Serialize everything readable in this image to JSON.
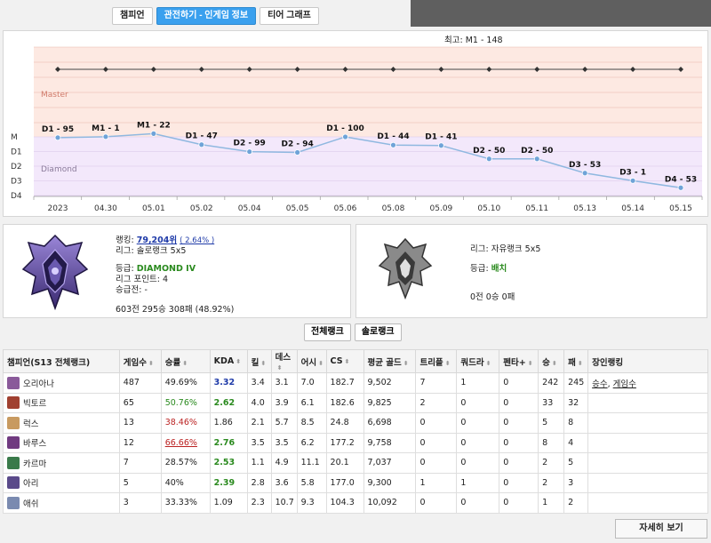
{
  "tabs": [
    "챔피언",
    "관전하기 - 인게임 정보",
    "티어 그래프"
  ],
  "chart": {
    "peak": "최고: M1 - 148",
    "y_labels": [
      "M",
      "D1",
      "D2",
      "D3",
      "D4"
    ],
    "zone_master": "Master",
    "zone_diamond": "Diamond",
    "x_labels": [
      "2023",
      "04.30",
      "05.01",
      "05.02",
      "05.04",
      "05.05",
      "05.06",
      "05.08",
      "05.09",
      "05.10",
      "05.11",
      "05.13",
      "05.14",
      "05.15"
    ],
    "point_labels": [
      "D1 - 95",
      "M1 - 1",
      "M1 - 22",
      "D1 - 47",
      "D2 - 99",
      "D2 - 94",
      "D1 - 100",
      "D1 - 44",
      "D1 - 41",
      "D2 - 50",
      "D2 - 50",
      "D3 - 53",
      "D3 - 1",
      "D4 - 53"
    ]
  },
  "chart_data": {
    "type": "line",
    "x": [
      "2023",
      "04.30",
      "05.01",
      "05.02",
      "05.04",
      "05.05",
      "05.06",
      "05.08",
      "05.09",
      "05.10",
      "05.11",
      "05.13",
      "05.14",
      "05.15"
    ],
    "series": [
      {
        "values": [
          -0.05,
          0.01,
          0.22,
          -0.53,
          -1.01,
          -1.06,
          0.0,
          -0.56,
          -0.59,
          -1.5,
          -1.5,
          -2.47,
          -2.99,
          -3.47
        ]
      }
    ],
    "y_ticks": [
      "M",
      "D1",
      "D2",
      "D3",
      "D4"
    ],
    "labels": [
      "D1 - 95",
      "M1 - 1",
      "M1 - 22",
      "D1 - 47",
      "D2 - 99",
      "D2 - 94",
      "D1 - 100",
      "D1 - 44",
      "D1 - 41",
      "D2 - 50",
      "D2 - 50",
      "D3 - 53",
      "D3 - 1",
      "D4 - 53"
    ]
  },
  "solo": {
    "ranking_label": "랭킹:",
    "ranking_value": "79,204위",
    "ranking_pct": "( 2.64% )",
    "league": "리그: 솔로랭크 5x5",
    "tier_label": "등급:",
    "tier_value": "DIAMOND IV",
    "lp": "리그 포인트: 4",
    "promo": "승급전: -",
    "record": "603전 295승 308패 (48.92%)"
  },
  "flex": {
    "league": "리그: 자유랭크 5x5",
    "tier_label": "등급:",
    "tier_value": "배치",
    "record": "0전 0승 0패"
  },
  "rank_buttons": [
    "전체랭크",
    "솔로랭크"
  ],
  "table": {
    "headers": [
      "챔피언(S13 전체랭크)",
      "게임수",
      "승률",
      "KDA",
      "킬",
      "데스",
      "어시",
      "CS",
      "평균 골드",
      "트리플",
      "쿼드라",
      "펜타+",
      "승",
      "패",
      "장인랭킹"
    ],
    "rows": [
      {
        "name": "오리아나",
        "games": "487",
        "wr": "49.69%",
        "kda": "3.32",
        "k": "3.4",
        "d": "3.1",
        "a": "7.0",
        "cs": "182.7",
        "gold": "9,502",
        "triple": "7",
        "quadra": "1",
        "penta": "0",
        "w": "242",
        "l": "245",
        "m1": "승수",
        "m2": "게임수",
        "color": "#8a5a9a"
      },
      {
        "name": "빅토르",
        "games": "65",
        "wr": "50.76%",
        "kda": "2.62",
        "k": "4.0",
        "d": "3.9",
        "a": "6.1",
        "cs": "182.6",
        "gold": "9,825",
        "triple": "2",
        "quadra": "0",
        "penta": "0",
        "w": "33",
        "l": "32",
        "m1": "",
        "m2": "",
        "color": "#a04030"
      },
      {
        "name": "럭스",
        "games": "13",
        "wr": "38.46%",
        "kda": "1.86",
        "k": "2.1",
        "d": "5.7",
        "a": "8.5",
        "cs": "24.8",
        "gold": "6,698",
        "triple": "0",
        "quadra": "0",
        "penta": "0",
        "w": "5",
        "l": "8",
        "m1": "",
        "m2": "",
        "color": "#c89a60"
      },
      {
        "name": "바루스",
        "games": "12",
        "wr": "66.66%",
        "kda": "2.76",
        "k": "3.5",
        "d": "3.5",
        "a": "6.2",
        "cs": "177.2",
        "gold": "9,758",
        "triple": "0",
        "quadra": "0",
        "penta": "0",
        "w": "8",
        "l": "4",
        "m1": "",
        "m2": "",
        "color": "#703a80"
      },
      {
        "name": "카르마",
        "games": "7",
        "wr": "28.57%",
        "kda": "2.53",
        "k": "1.1",
        "d": "4.9",
        "a": "11.1",
        "cs": "20.1",
        "gold": "7,037",
        "triple": "0",
        "quadra": "0",
        "penta": "0",
        "w": "2",
        "l": "5",
        "m1": "",
        "m2": "",
        "color": "#3a7a4a"
      },
      {
        "name": "아리",
        "games": "5",
        "wr": "40%",
        "kda": "2.39",
        "k": "2.8",
        "d": "3.6",
        "a": "5.8",
        "cs": "177.0",
        "gold": "9,300",
        "triple": "1",
        "quadra": "1",
        "penta": "0",
        "w": "2",
        "l": "3",
        "m1": "",
        "m2": "",
        "color": "#5a4a8a"
      },
      {
        "name": "애쉬",
        "games": "3",
        "wr": "33.33%",
        "kda": "1.09",
        "k": "2.3",
        "d": "10.7",
        "a": "9.3",
        "cs": "104.3",
        "gold": "10,092",
        "triple": "0",
        "quadra": "0",
        "penta": "0",
        "w": "1",
        "l": "2",
        "m1": "",
        "m2": "",
        "color": "#7a8ab0"
      }
    ]
  },
  "detail_button": "자세히 보기"
}
